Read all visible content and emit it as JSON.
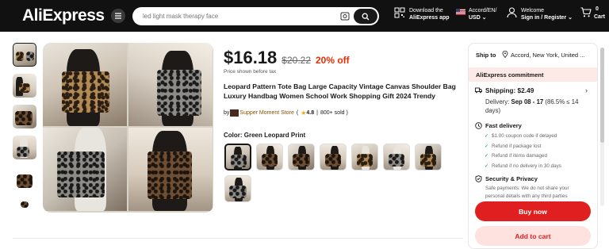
{
  "header": {
    "logo": "AliExpress",
    "search_placeholder": "led light mask therapy face",
    "app_line1": "Download the",
    "app_line2": "AliExpress app",
    "locale_line1": "Accord/EN/",
    "locale_line2": "USD",
    "welcome_line1": "Welcome",
    "welcome_line2": "Sign in / Register",
    "cart_count": "0",
    "cart_label": "Cart"
  },
  "product": {
    "price": "$16.18",
    "original_price": "$20.22",
    "discount": "20% off",
    "tax_note": "Price shown before tax",
    "title": "Leopard Pattern Tote Bag Large Capacity Vintage Canvas Shoulder Bag Luxury Handbag Women School Work Shopping Gift 2024 Trendy",
    "store_prefix": "by",
    "store_name": "Supper Moment Store",
    "rating": "4.8",
    "sold": "800+ sold",
    "color_label": "Color: Green Leopard Print"
  },
  "panel": {
    "ship_to_label": "Ship to",
    "location": "Accord, New York, United ...",
    "commitment": "AliExpress commitment",
    "shipping": "Shipping: $2.49",
    "delivery_prefix": "Delivery:",
    "delivery_dates": "Sep 08 - 17",
    "delivery_rate": "(86.5% ≤ 14 days)",
    "fast_delivery": "Fast delivery",
    "fast_items": [
      "$1.00 coupon code if delayed",
      "Refund if package lost",
      "Refund if items damaged",
      "Refund if no delivery in 30 days"
    ],
    "security_title": "Security & Privacy",
    "security_text": "Safe payments: We do not share your personal details with any third parties",
    "buy_now": "Buy now",
    "add_to_cart": "Add to cart"
  },
  "colors": {
    "accent": "#e02020",
    "header_bg": "#111111",
    "discount": "#e62e04",
    "commit_bg": "#fde9e6"
  }
}
